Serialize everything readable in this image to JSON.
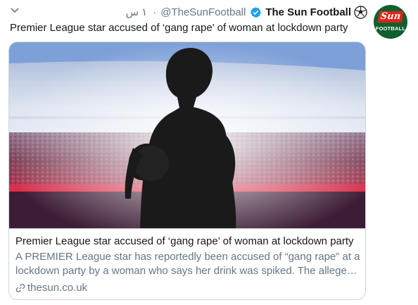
{
  "tweet": {
    "time": "١ س",
    "handle": "@TheSunFootball",
    "display_name": "The Sun Football",
    "text": "Premier League star accused of ‘gang rape’ of woman at lockdown party",
    "avatar_logo_text": "Sun",
    "avatar_logo_caption": "FOOTBALL"
  },
  "card": {
    "title": "Premier League star accused of ‘gang rape’ of woman at lockdown party",
    "description_line1": "A PREMIER League star has reportedly been accused of “gang rape” at a",
    "description_line2": "lockdown party by a woman who says her drink was spiked. The allege…",
    "domain": "thesun.co.uk"
  },
  "icons": {
    "caret": "chevron-down-icon",
    "verified": "verified-badge-icon",
    "ball": "football-emoji-icon",
    "link": "link-icon"
  },
  "colors": {
    "text": "#14171a",
    "secondary": "#657786",
    "border": "#ccd6dd",
    "verified": "#1da1f2",
    "avatar_bg": "#0f5f2f",
    "sun_red": "#e2231a"
  }
}
